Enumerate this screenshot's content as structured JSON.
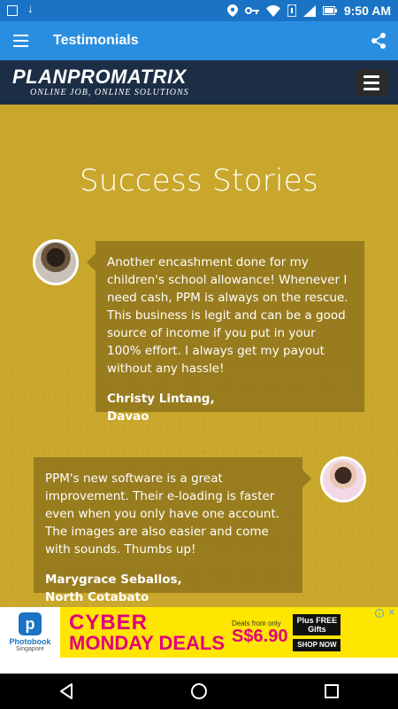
{
  "status_bar": {
    "time": "9:50 AM"
  },
  "app_bar": {
    "title": "Testimonials"
  },
  "site": {
    "logo_main": "PLANPROMATRIX",
    "logo_tagline": "ONLINE JOB, ONLINE SOLUTIONS"
  },
  "section": {
    "title": "Success Stories"
  },
  "testimonials": [
    {
      "quote": "Another encashment done for my children's school allowance! Whenever I need cash, PPM is always on the rescue. This business is legit and can be a good source of income if you put in your 100% effort. I always get my payout without any hassle!",
      "author": "Christy Lintang,\nDavao"
    },
    {
      "quote": "PPM's new software is a great improvement. Their e-loading is faster even when you only have one account. The images are also easier and come with sounds. Thumbs up!",
      "author": "Marygrace Seballos,\nNorth Cotabato"
    }
  ],
  "ad": {
    "brand": "Photobook",
    "brand_region": "Singapore",
    "headline_1": "CYBER",
    "headline_2": "MONDAY DEALS",
    "price_prefix": "Deals from only",
    "price": "S$6.90",
    "plus_text": "Plus FREE Gifts",
    "cta": "SHOP NOW"
  },
  "icons": {
    "menu": "hamburger-icon",
    "share": "share-icon",
    "back": "back-icon",
    "home": "home-icon",
    "recents": "recents-icon"
  }
}
